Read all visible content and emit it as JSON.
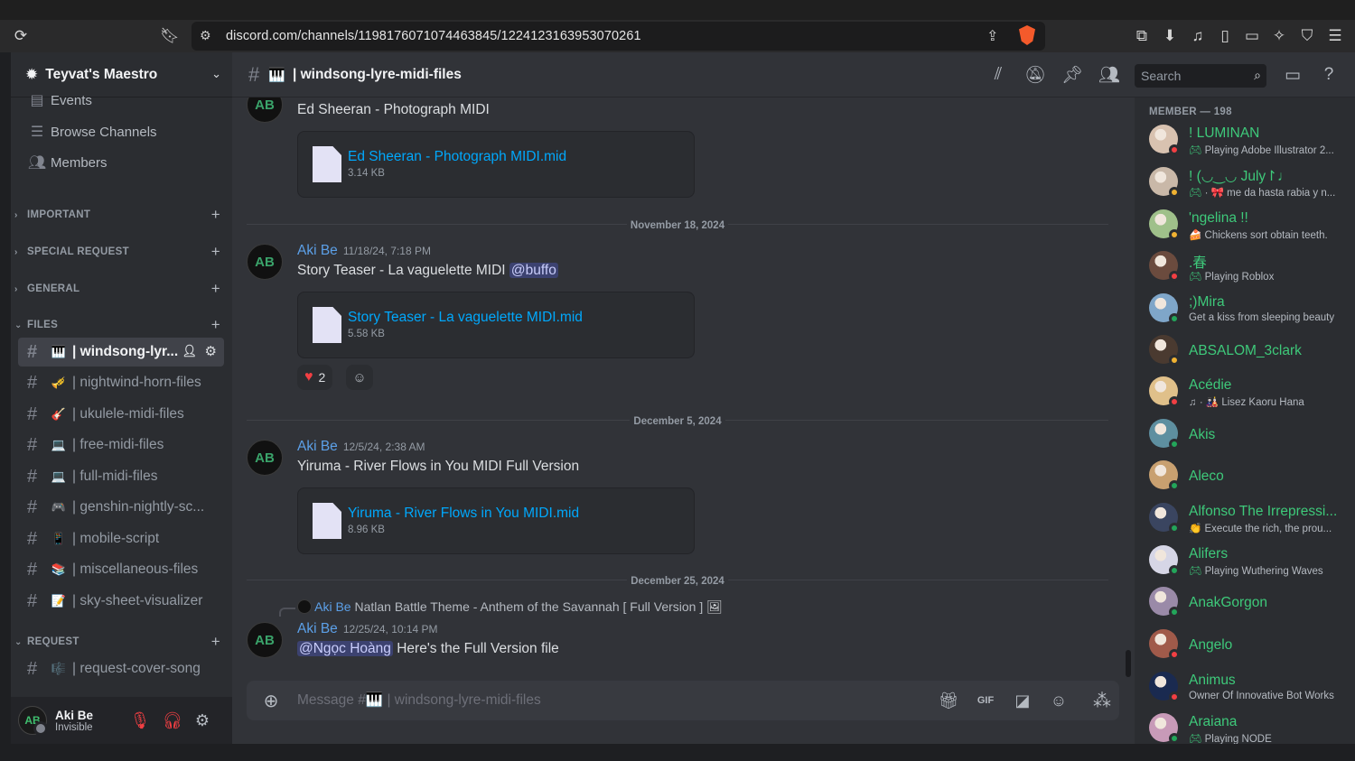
{
  "browser": {
    "url": "discord.com/channels/1198176071074463845/1224123163953070261"
  },
  "server": {
    "name": "Teyvat's Maestro"
  },
  "sidebar": {
    "top_items": [
      {
        "label": "Events",
        "icon": "calendar-icon"
      },
      {
        "label": "Browse Channels",
        "icon": "browse-channels-icon"
      },
      {
        "label": "Members",
        "icon": "members-icon"
      }
    ],
    "categories": {
      "important": "IMPORTANT",
      "special_request": "SPECIAL REQUEST",
      "general": "GENERAL",
      "files": "FILES",
      "request": "REQUEST"
    },
    "channels": [
      {
        "emoji": "🎹",
        "label": "| windsong-lyr..."
      },
      {
        "emoji": "🎺",
        "label": "| nightwind-horn-files"
      },
      {
        "emoji": "🎸",
        "label": "| ukulele-midi-files"
      },
      {
        "emoji": "💻",
        "label": "| free-midi-files"
      },
      {
        "emoji": "💻",
        "label": "| full-midi-files"
      },
      {
        "emoji": "🎮",
        "label": "| genshin-nightly-sc..."
      },
      {
        "emoji": "📱",
        "label": "| mobile-script"
      },
      {
        "emoji": "📚",
        "label": "| miscellaneous-files"
      },
      {
        "emoji": "📝",
        "label": "| sky-sheet-visualizer"
      },
      {
        "emoji": "🎼",
        "label": "| request-cover-song"
      }
    ]
  },
  "user": {
    "name": "Aki Be",
    "status": "Invisible"
  },
  "channel": {
    "emoji": "🎹",
    "title": "| windsong-lyre-midi-files",
    "search_placeholder": "Search"
  },
  "messages": {
    "m0_text": "Ed Sheeran - Photograph MIDI",
    "m0_file": {
      "name": "Ed Sheeran - Photograph MIDI.mid",
      "size": "3.14 KB"
    },
    "d1": "November 18, 2024",
    "m1_author": "Aki Be",
    "m1_time": "11/18/24, 7:18 PM",
    "m1_text": "Story Teaser - La vaguelette MIDI",
    "m1_mention": "@buffo",
    "m1_file": {
      "name": "Story Teaser - La vaguelette MIDI.mid",
      "size": "5.58 KB"
    },
    "m1_reaction_emoji": "❤️",
    "m1_reaction_count": "2",
    "d2": "December 5, 2024",
    "m2_author": "Aki Be",
    "m2_time": "12/5/24, 2:38 AM",
    "m2_text": "Yiruma - River Flows in You MIDI Full Version",
    "m2_file": {
      "name": "Yiruma - River Flows in You MIDI.mid",
      "size": "8.96 KB"
    },
    "d3": "December 25, 2024",
    "m3_reply_author": "Aki Be",
    "m3_reply_text": "Natlan Battle Theme - Anthem of the Savannah [ Full Version ]",
    "m3_author": "Aki Be",
    "m3_time": "12/25/24, 10:14 PM",
    "m3_mention": "@Ngọc Hoàng",
    "m3_text": "Here's the Full Version file"
  },
  "composer": {
    "placeholder_prefix": "Message #",
    "placeholder_emoji": "🎹",
    "placeholder_channel": "| windsong-lyre-midi-files"
  },
  "members": {
    "header": "MEMBER — 198",
    "list": [
      {
        "name": "! LUMINAN",
        "activity": "Playing Adobe Illustrator 2...",
        "game": true,
        "status": "dnd",
        "avatar": "#d8c2b0"
      },
      {
        "name": "! (◡‿◡ July↾♩",
        "activity": "· 🎀 me da hasta rabia y n...",
        "game": true,
        "status": "idle",
        "avatar": "#c9b8a8"
      },
      {
        "name": "'ngelina !!",
        "activity": "🍰 Chickens sort obtain teeth.",
        "game": false,
        "status": "idle",
        "avatar": "#9fc08a"
      },
      {
        "name": ".春",
        "activity": "Playing Roblox",
        "game": true,
        "status": "dnd",
        "avatar": "#6b4b3e"
      },
      {
        "name": ";)Mira",
        "activity": "Get a kiss from sleeping beauty",
        "game": false,
        "status": "online",
        "avatar": "#7fa6c9"
      },
      {
        "name": "ABSALOM_3clark",
        "activity": "",
        "game": false,
        "status": "idle",
        "avatar": "#4a3a30"
      },
      {
        "name": "Acédie",
        "activity": "♫ · 🎎 Lisez Kaoru Hana",
        "game": false,
        "status": "dnd",
        "avatar": "#e0c08a"
      },
      {
        "name": "Akis",
        "activity": "",
        "game": false,
        "status": "online",
        "avatar": "#5e8fa0"
      },
      {
        "name": "Aleco",
        "activity": "",
        "game": false,
        "status": "online",
        "avatar": "#c8a070"
      },
      {
        "name": "Alfonso The Irrepressi...",
        "activity": "👏 Execute the rich, the prou...",
        "game": false,
        "status": "online",
        "avatar": "#3a4560"
      },
      {
        "name": "Alifers",
        "activity": "Playing Wuthering Waves",
        "game": true,
        "status": "online",
        "avatar": "#d6d6e6"
      },
      {
        "name": "AnakGorgon",
        "activity": "",
        "game": false,
        "status": "online",
        "avatar": "#9a8aa8"
      },
      {
        "name": "Angelo",
        "activity": "",
        "game": false,
        "status": "dnd",
        "avatar": "#a05a4a"
      },
      {
        "name": "Animus",
        "activity": "Owner Of Innovative Bot Works",
        "game": false,
        "status": "dnd",
        "avatar": "#1a2a50"
      },
      {
        "name": "Araiana",
        "activity": "Playing NODE",
        "game": true,
        "status": "online",
        "avatar": "#c89ab8"
      }
    ]
  },
  "colors": {
    "online": "#23a55a",
    "idle": "#f0b232",
    "dnd": "#f23f43"
  }
}
